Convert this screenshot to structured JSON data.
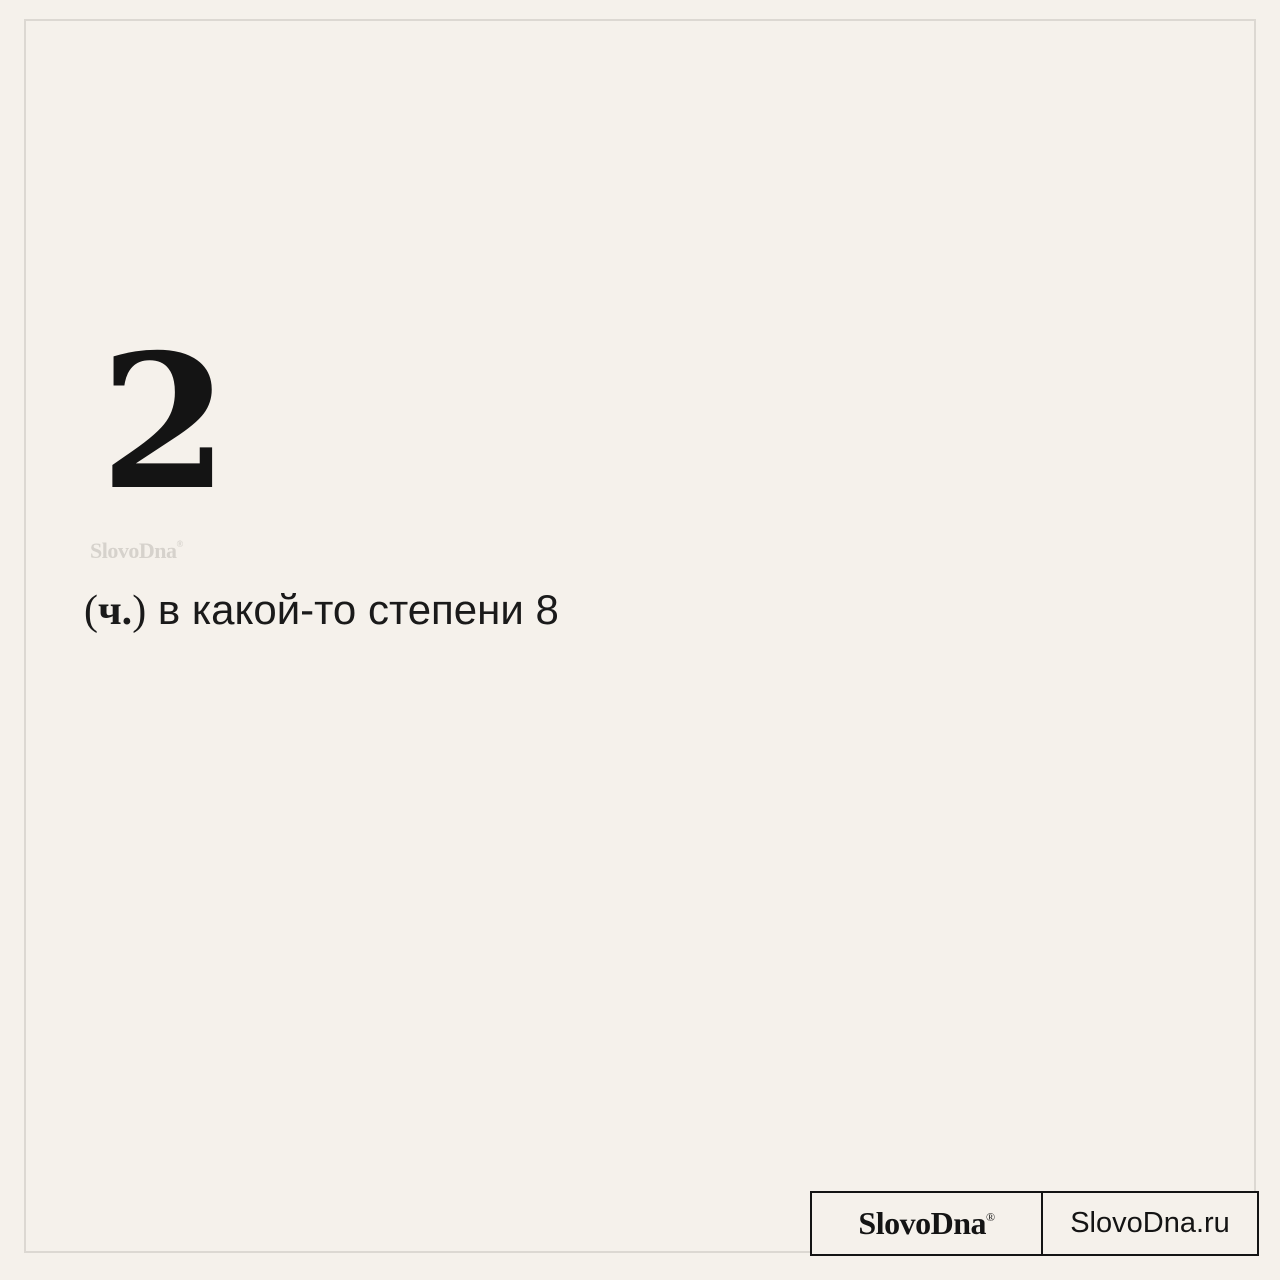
{
  "card": {
    "headword": "2",
    "watermark": "SlovoDna",
    "registered_mark": "®",
    "definition": {
      "paren_open": "(",
      "abbr": "ч.",
      "paren_close": ")",
      "text": " в какой-то степени 8"
    }
  },
  "badge": {
    "logo": "SlovoDna",
    "registered_mark": "®",
    "site": "SlovoDna.ru"
  },
  "colors": {
    "background": "#f5f1eb",
    "frame": "#dcd8d2",
    "text": "#141414",
    "watermark": "#d6d2cc"
  }
}
